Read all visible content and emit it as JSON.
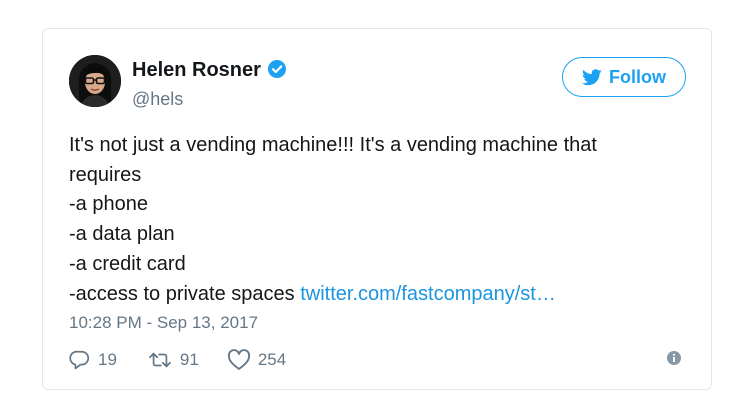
{
  "author": {
    "display_name": "Helen Rosner",
    "handle": "@hels",
    "verified": true,
    "avatar_icon": "avatar-photo"
  },
  "follow_button": {
    "label": "Follow",
    "icon": "twitter-bird-icon"
  },
  "tweet": {
    "lines": [
      "It's not just a vending machine!!! It's a vending machine that",
      "requires",
      "-a phone",
      "-a data plan",
      "-a credit card"
    ],
    "last_line_text": "-access to private spaces ",
    "link_text": "twitter.com/fastcompany/st…",
    "timestamp": "10:28 PM - Sep 13, 2017"
  },
  "actions": {
    "replies": "19",
    "retweets": "91",
    "likes": "254"
  },
  "colors": {
    "accent": "#1da1f2",
    "link": "#1b95e0",
    "text": "#14171a",
    "muted": "#657786",
    "border": "#e1e8ed"
  }
}
